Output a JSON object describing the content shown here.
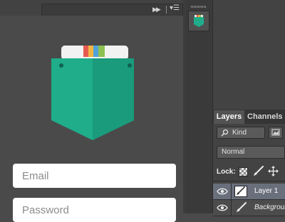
{
  "colors": {
    "pocket_green": "#1fad8a",
    "pocket_green_dark": "#1a9b7c",
    "stripe_red": "#e65a4e",
    "stripe_yellow": "#f2b544",
    "stripe_blue": "#4fa3d8",
    "stripe_green": "#8cc152",
    "selected_layer_bg": "#6a6f7c"
  },
  "form": {
    "email_placeholder": "Email",
    "password_placeholder": "Password"
  },
  "panel": {
    "tabs": [
      "Layers",
      "Channels"
    ],
    "filter_label": "Kind",
    "blend_mode": "Normal",
    "lock_label": "Lock:"
  },
  "layers": [
    {
      "name": "Layer 1",
      "selected": true
    },
    {
      "name": "Background",
      "selected": false
    }
  ],
  "icons": {
    "collapse": "double-chevron-right-icon",
    "panel_menu": "panel-menu-icon",
    "search": "search-icon",
    "image_filter": "image-filter-icon",
    "lock_transparent": "checkerboard-icon",
    "lock_image": "brush-icon",
    "lock_position": "move-arrows-icon",
    "visibility": "eye-icon"
  }
}
